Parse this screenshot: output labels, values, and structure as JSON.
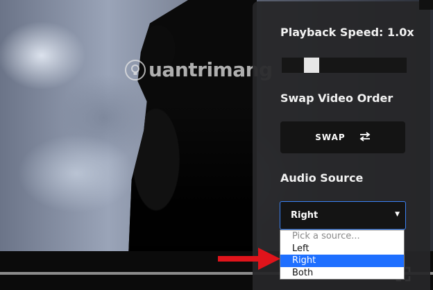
{
  "watermark": {
    "text": "uantrimang"
  },
  "panel": {
    "playback_speed_label": "Playback Speed: 1.0x",
    "playback_speed_value": 1.0,
    "playback_speed_slider_fraction": 0.2,
    "swap_heading": "Swap Video Order",
    "swap_button_label": "SWAP",
    "swap_icon": "swap-arrows-icon",
    "audio_heading": "Audio Source",
    "audio_select_value": "Right",
    "audio_options": [
      {
        "label": "Pick a source...",
        "placeholder": true
      },
      {
        "label": "Left"
      },
      {
        "label": "Right",
        "selected": true
      },
      {
        "label": "Both"
      }
    ]
  },
  "player": {
    "fullscreen_icon": "fullscreen-icon"
  },
  "colors": {
    "accent_blue": "#1e6fff",
    "select_border": "#3b82f6",
    "arrow_red": "#e0141b",
    "panel_bg": "#262628"
  }
}
